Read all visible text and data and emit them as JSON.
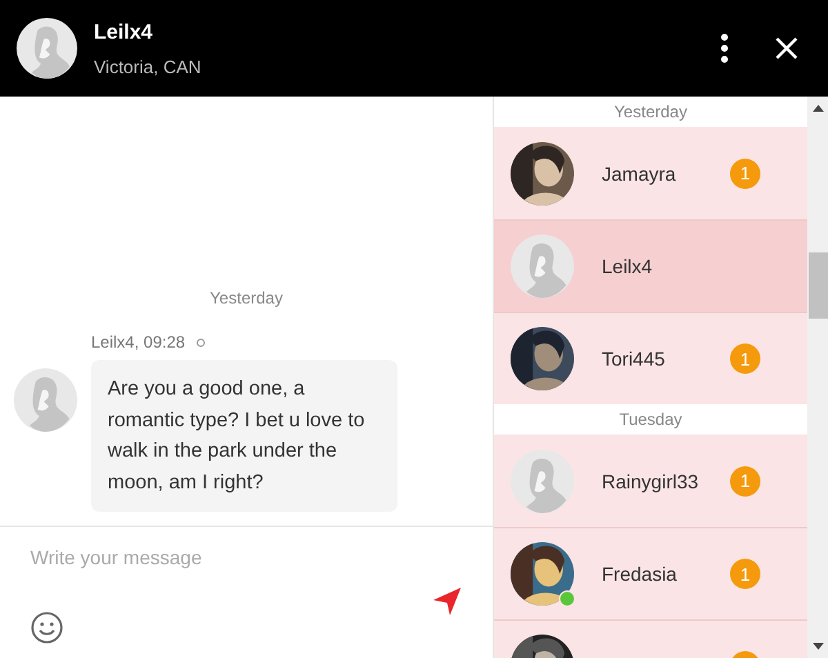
{
  "header": {
    "name": "Leilx4",
    "location": "Victoria, CAN",
    "avatar": {
      "kind": "silhouette"
    }
  },
  "chat": {
    "date_label": "Yesterday",
    "messages": [
      {
        "meta": "Leilx4, 09:28",
        "avatar": {
          "kind": "silhouette"
        },
        "text": "Are you a good one, a romantic type? I bet u love to walk in the park under the moon, am I right?"
      }
    ]
  },
  "composer": {
    "placeholder": "Write your message"
  },
  "contact_groups": [
    {
      "label": "Yesterday",
      "contacts": [
        {
          "name": "Jamayra",
          "unread": "1",
          "selected": false,
          "online": false
        },
        {
          "name": "Leilx4",
          "avatar": {
            "kind": "silhouette"
          },
          "selected": true,
          "online": false
        },
        {
          "name": "Tori445",
          "unread": "1",
          "selected": false,
          "online": false
        }
      ]
    },
    {
      "label": "Tuesday",
      "contacts": [
        {
          "name": "Rainygirl33",
          "avatar": {
            "kind": "silhouette"
          },
          "unread": "1",
          "selected": false,
          "online": false
        },
        {
          "name": "Fredasia",
          "unread": "1",
          "selected": false,
          "online": true
        },
        {
          "badge": true,
          "selected": false
        }
      ]
    }
  ]
}
